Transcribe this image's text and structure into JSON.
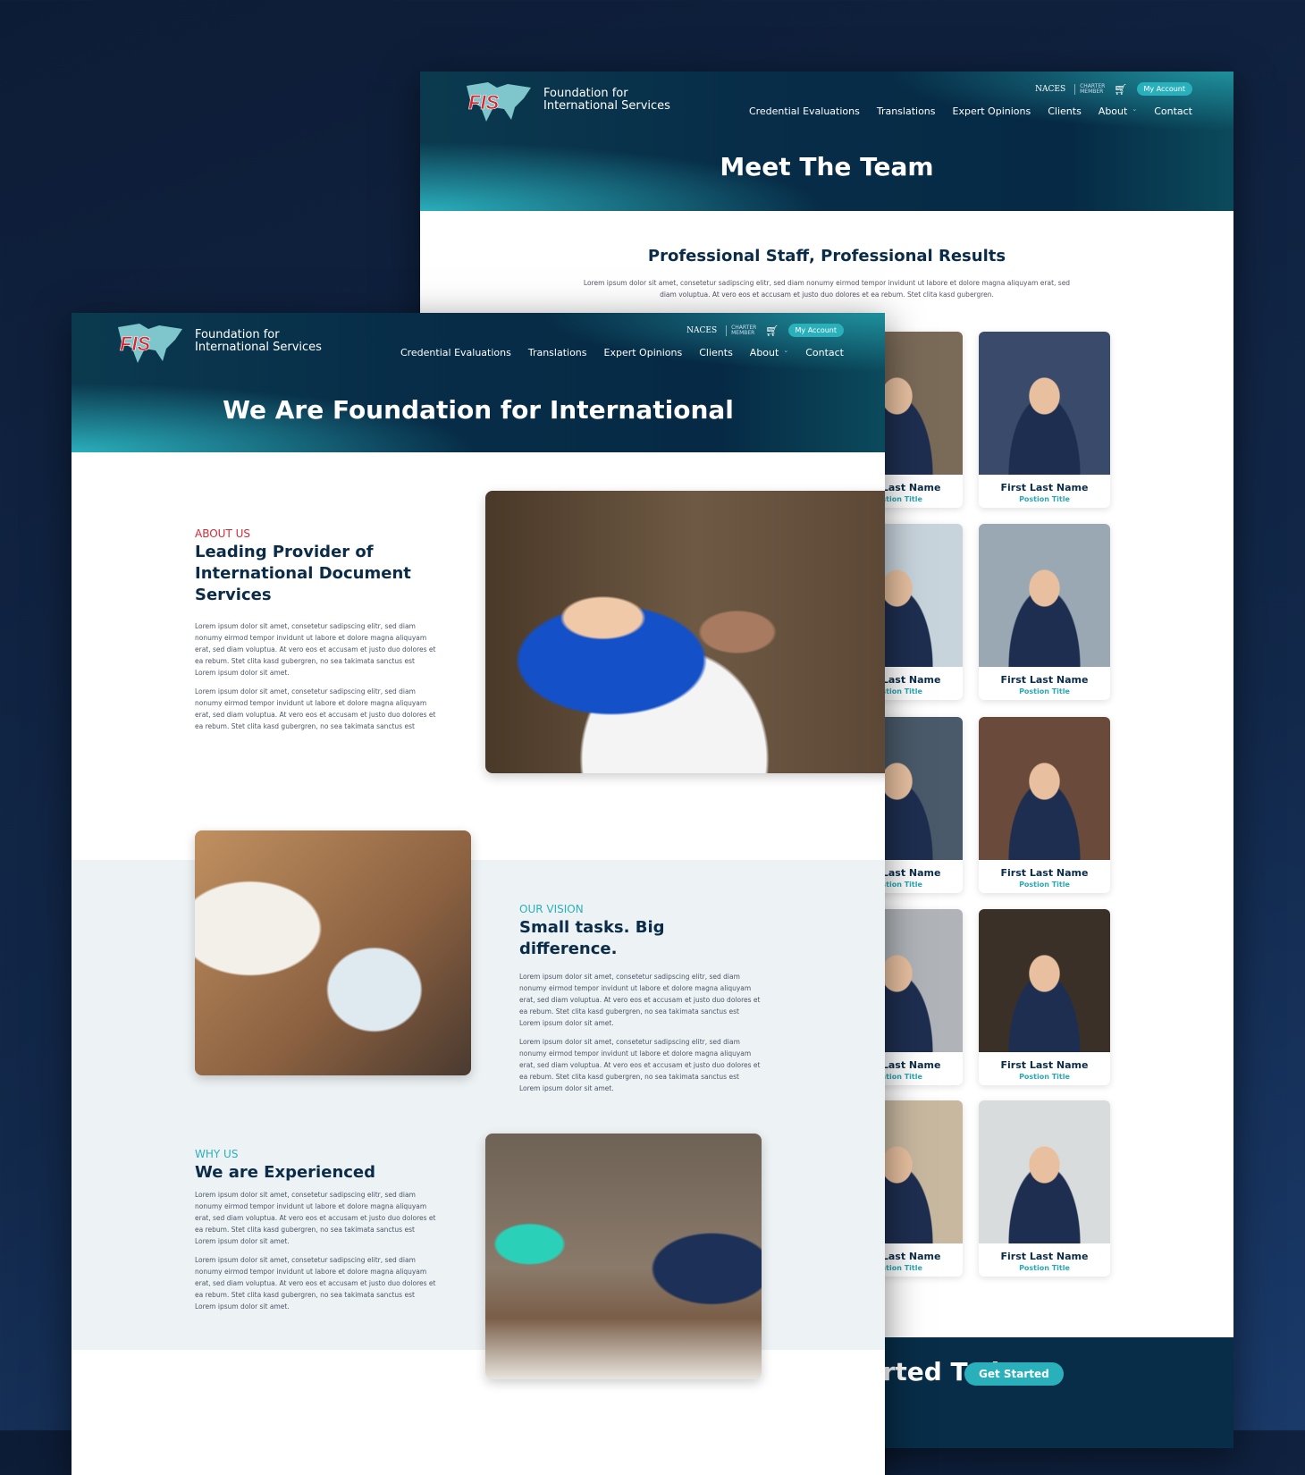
{
  "brand": {
    "line1": "Foundation for",
    "line2": "International Services",
    "logo_text": "FIS"
  },
  "utility": {
    "naces": "NACES",
    "charter": "CHARTER",
    "member": "MEMBER",
    "cart_icon": "cart-icon",
    "account": "My Account"
  },
  "nav": [
    "Credential Evaluations",
    "Translations",
    "Expert Opinions",
    "Clients",
    "About",
    "Contact"
  ],
  "team_page": {
    "hero": "Meet The Team",
    "heading": "Professional Staff, Professional Results",
    "intro": "Lorem ipsum dolor sit amet, consetetur sadipscing elitr, sed diam nonumy eirmod tempor invidunt ut labore et dolore magna aliquyam erat, sed diam voluptua. At vero eos et accusam et justo duo dolores et ea rebum. Stet clita kasd gubergren.",
    "members": [
      {
        "name": "First Last Name",
        "title": "Postion Title"
      }
    ],
    "cta": {
      "text": "Get Started Today",
      "button": "Get Started"
    }
  },
  "about_page": {
    "hero": "We Are Foundation for International",
    "sections": [
      {
        "eyebrow": "ABOUT US",
        "heading": "Leading Provider of International Document Services",
        "p1": "Lorem ipsum dolor sit amet, consetetur sadipscing elitr, sed diam nonumy eirmod tempor invidunt ut labore et dolore magna aliquyam erat, sed diam voluptua. At vero eos et accusam et justo duo dolores et ea rebum. Stet clita kasd gubergren, no sea takimata sanctus est Lorem ipsum dolor sit amet.",
        "p2": "Lorem ipsum dolor sit amet, consetetur sadipscing elitr, sed diam nonumy eirmod tempor invidunt ut labore et dolore magna aliquyam erat, sed diam voluptua. At vero eos et accusam et justo duo dolores et ea rebum. Stet clita kasd gubergren, no sea takimata sanctus est"
      },
      {
        "eyebrow": "OUR VISION",
        "heading": "Small tasks. Big difference.",
        "p1": "Lorem ipsum dolor sit amet, consetetur sadipscing elitr, sed diam nonumy eirmod tempor invidunt ut labore et dolore magna aliquyam erat, sed diam voluptua. At vero eos et accusam et justo duo dolores et ea rebum. Stet clita kasd gubergren, no sea takimata sanctus est Lorem ipsum dolor sit amet.",
        "p2": "Lorem ipsum dolor sit amet, consetetur sadipscing elitr, sed diam nonumy eirmod tempor invidunt ut labore et dolore magna aliquyam erat, sed diam voluptua. At vero eos et accusam et justo duo dolores et ea rebum. Stet clita kasd gubergren, no sea takimata sanctus est Lorem ipsum dolor sit amet."
      },
      {
        "eyebrow": "WHY US",
        "heading": "We are Experienced",
        "p1": "Lorem ipsum dolor sit amet, consetetur sadipscing elitr, sed diam nonumy eirmod tempor invidunt ut labore et dolore magna aliquyam erat, sed diam voluptua. At vero eos et accusam et justo duo dolores et ea rebum. Stet clita kasd gubergren, no sea takimata sanctus est Lorem ipsum dolor sit amet.",
        "p2": "Lorem ipsum dolor sit amet, consetetur sadipscing elitr, sed diam nonumy eirmod tempor invidunt ut labore et dolore magna aliquyam erat, sed diam voluptua. At vero eos et accusam et justo duo dolores et ea rebum. Stet clita kasd gubergren, no sea takimata sanctus est Lorem ipsum dolor sit amet."
      }
    ]
  },
  "colors": {
    "accent": "#2ab0bb",
    "navy": "#0b2c48",
    "red": "#d42a36",
    "band": "#edf2f5"
  }
}
